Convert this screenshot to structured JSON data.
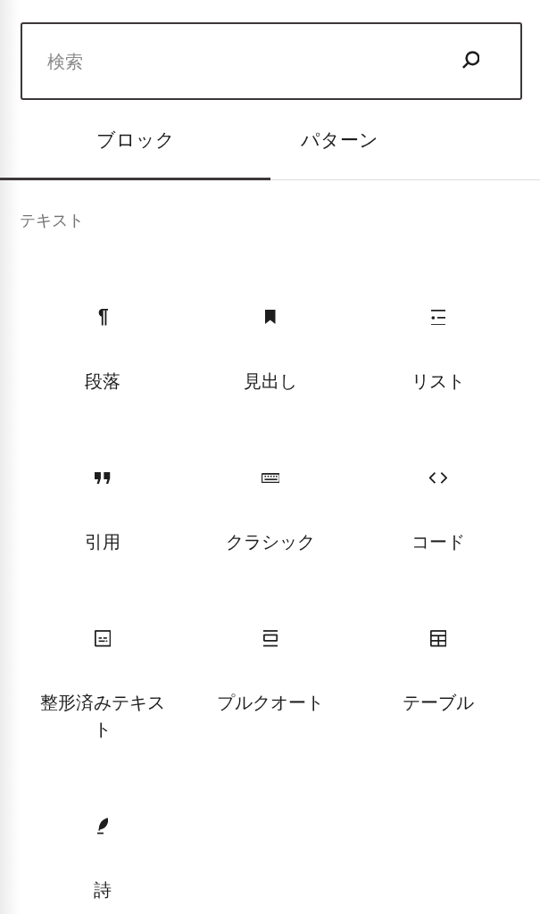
{
  "search": {
    "placeholder": "検索"
  },
  "tabs": [
    {
      "label": "ブロック",
      "selected": true
    },
    {
      "label": "パターン",
      "selected": false
    }
  ],
  "category": {
    "title": "テキスト"
  },
  "blocks": [
    {
      "kind": "paragraph",
      "label": "段落"
    },
    {
      "kind": "heading",
      "label": "見出し"
    },
    {
      "kind": "list",
      "label": "リスト"
    },
    {
      "kind": "quote",
      "label": "引用"
    },
    {
      "kind": "classic",
      "label": "クラシック"
    },
    {
      "kind": "code",
      "label": "コード"
    },
    {
      "kind": "preformatted",
      "label": "整形済みテキスト"
    },
    {
      "kind": "pullquote",
      "label": "プルクオート"
    },
    {
      "kind": "table",
      "label": "テーブル"
    },
    {
      "kind": "verse",
      "label": "詩"
    }
  ]
}
